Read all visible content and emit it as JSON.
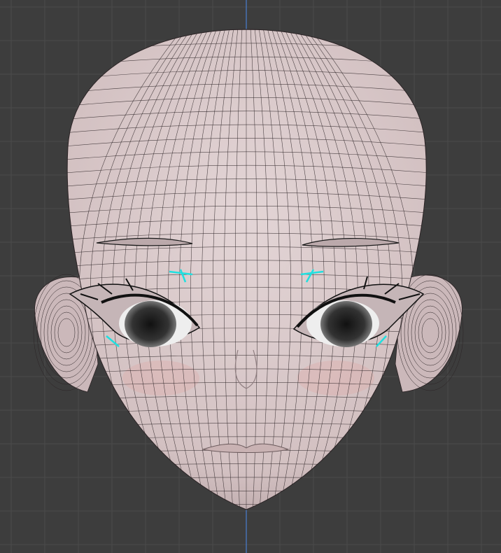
{
  "viewport": {
    "mode": "wireframe-overlay",
    "colors": {
      "background": "#3d3d3d",
      "grid": "#4a4a4a",
      "axis": "#4a7fd0",
      "skin": "#d9c9ca",
      "skin_shade": "#b9a6a8",
      "blush": "#e0aaa5",
      "wire": "#2a2224",
      "selection": "#1fe0e0",
      "iris": "#2a2a2a"
    },
    "icons": [
      "head-mesh",
      "ear-left",
      "ear-right",
      "eye-left",
      "eye-right"
    ]
  }
}
